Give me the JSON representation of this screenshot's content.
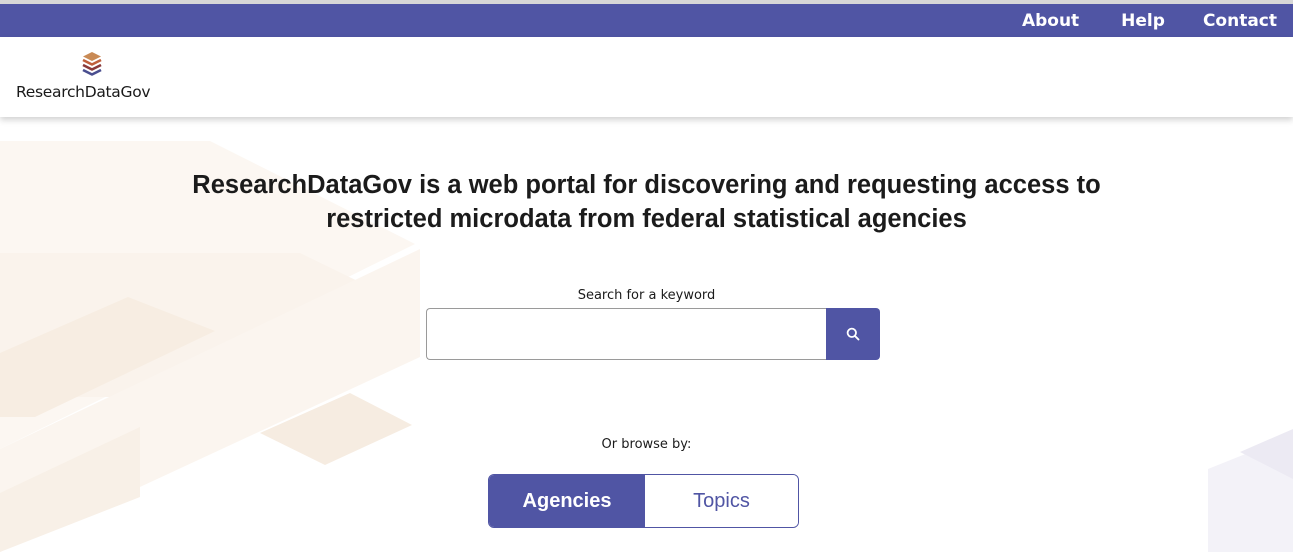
{
  "colors": {
    "brand": "#5055a4",
    "text": "#1b1b1b",
    "background_decoration": "#faf4ee"
  },
  "top_nav": {
    "items": [
      {
        "label": "About"
      },
      {
        "label": "Help"
      },
      {
        "label": "Contact"
      }
    ]
  },
  "header": {
    "logo_text": "ResearchDataGov",
    "logo_icon": "stacked-books-icon"
  },
  "hero": {
    "headline_line1": "ResearchDataGov is a web portal for discovering and requesting access to",
    "headline_line2": "restricted microdata from federal statistical agencies",
    "search": {
      "label": "Search for a keyword",
      "value": "",
      "placeholder": "",
      "button_icon": "search-icon"
    },
    "browse": {
      "label": "Or browse by:",
      "options": [
        {
          "label": "Agencies",
          "selected": true
        },
        {
          "label": "Topics",
          "selected": false
        }
      ]
    }
  }
}
